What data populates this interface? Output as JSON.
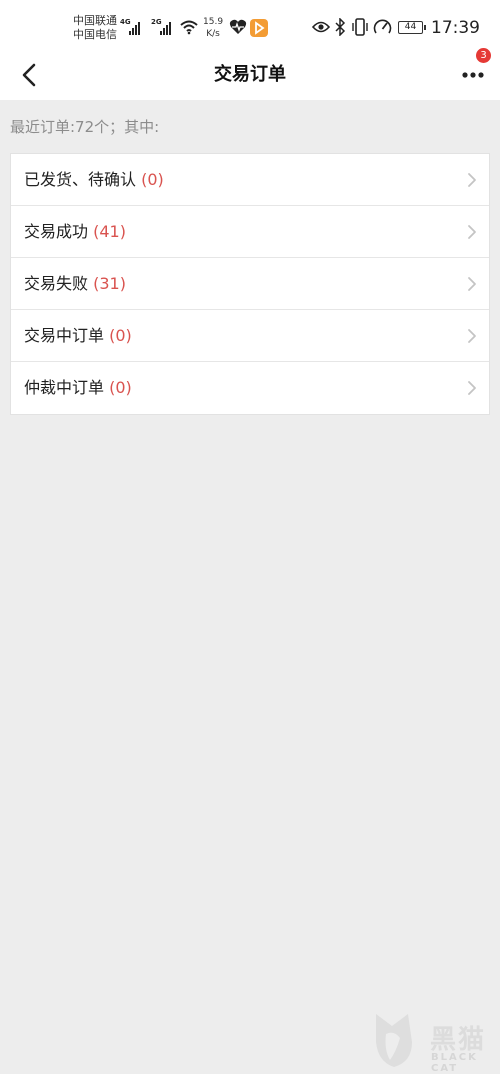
{
  "status_bar": {
    "carrier_1": "中国联通",
    "carrier_2": "中国电信",
    "network_1": "4G",
    "network_2": "2G",
    "speed_value": "15.9",
    "speed_unit": "K/s",
    "battery": "44",
    "time": "17:39",
    "icons": [
      "signal-icon",
      "wifi-icon",
      "heart-rate-icon",
      "video-app-icon",
      "eye-icon",
      "bluetooth-icon",
      "vibrate-icon",
      "speedometer-icon",
      "battery-icon"
    ]
  },
  "nav": {
    "title": "交易订单",
    "back_icon": "chevron-left-icon",
    "more_icon": "more-dots-icon",
    "badge_count": "3"
  },
  "summary": "最近订单:72个；其中:",
  "orders": [
    {
      "label": "已发货、待确认",
      "count": "(0)"
    },
    {
      "label": "交易成功",
      "count": "(41)"
    },
    {
      "label": "交易失败",
      "count": "(31)"
    },
    {
      "label": "交易中订单",
      "count": "(0)"
    },
    {
      "label": "仲裁中订单",
      "count": "(0)"
    }
  ],
  "watermark": {
    "title": "黑猫",
    "subtitle": "BLACK CAT"
  },
  "colors": {
    "accent_red": "#d9534f",
    "badge_red": "#e53935",
    "background": "#ededed"
  }
}
